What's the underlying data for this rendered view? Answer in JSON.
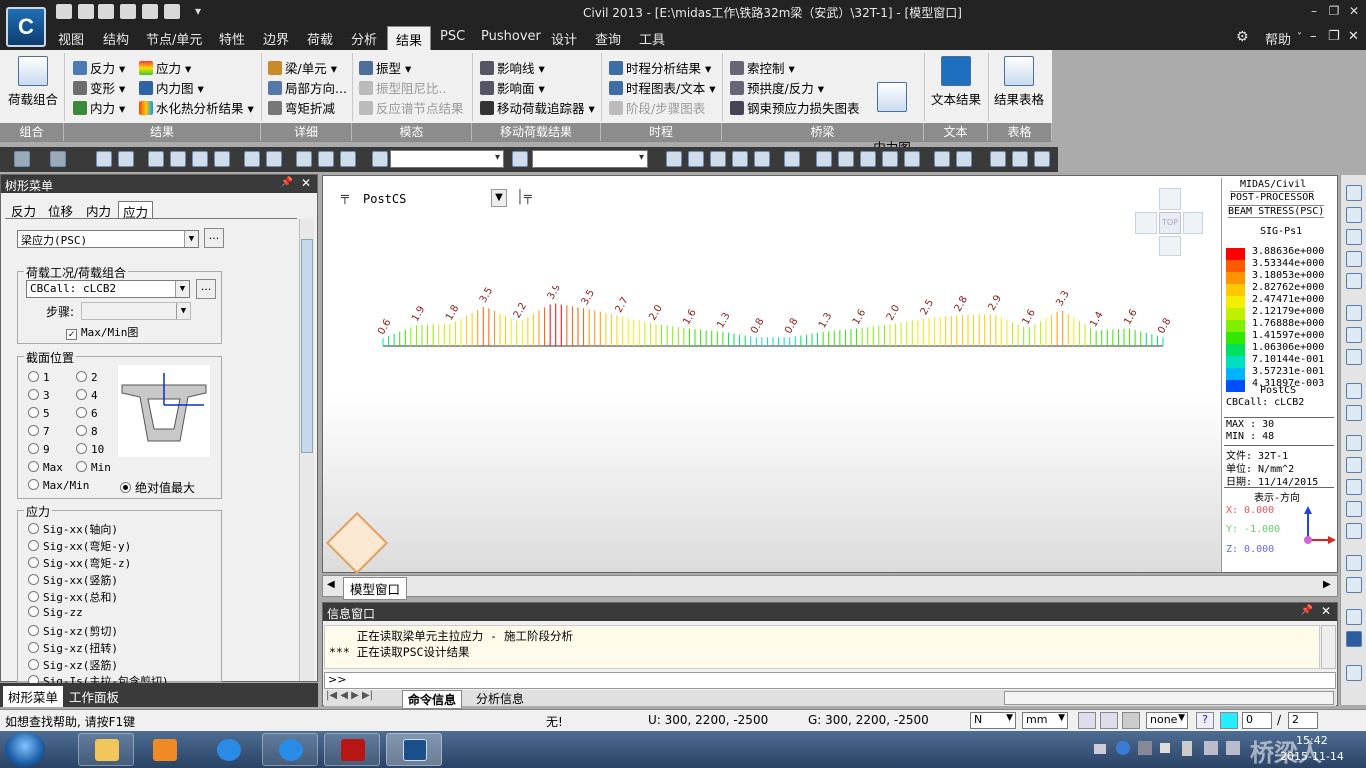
{
  "title": {
    "text": "Civil 2013 - [E:\\midas工作\\铁路32m梁（安武）\\32T-1] - [模型窗口]",
    "logo_letter": "C"
  },
  "menu": {
    "tabs": [
      "视图",
      "结构",
      "节点/单元",
      "特性",
      "边界",
      "荷载",
      "分析",
      "结果",
      "PSC",
      "Pushover",
      "设计",
      "查询",
      "工具"
    ],
    "active": "结果",
    "help": "帮助"
  },
  "ribbon": {
    "combo_big": "荷载组合",
    "results_col1": [
      "反力",
      "变形",
      "内力"
    ],
    "results_col2": [
      "应力",
      "内力图",
      "水化热分析结果"
    ],
    "detail": [
      "梁/单元",
      "局部方向...",
      "弯矩折减"
    ],
    "mode": [
      "振型",
      "振型阻尼比..",
      "反应谱节点结果"
    ],
    "moving": [
      "影响线",
      "影响面",
      "移动荷载追踪器"
    ],
    "timehist": [
      "时程分析结果",
      "时程图表/文本",
      "阶段/步骤图表"
    ],
    "bridge": [
      "索控制",
      "预拱度/反力",
      "钢束预应力损失图表"
    ],
    "bridge_big": "桥梁主梁\n内力图",
    "text_big": "文本结果",
    "table_big": "结果表格",
    "sections": [
      "组合",
      "结果",
      "详细",
      "模态",
      "移动荷载结果",
      "时程",
      "桥梁",
      "文本",
      "表格"
    ]
  },
  "tree": {
    "title": "树形菜单",
    "tabs": [
      "反力",
      "位移",
      "内力",
      "应力"
    ],
    "active_tab": "应力",
    "stress_type": "梁应力(PSC)",
    "case_group_label": "荷载工况/荷载组合",
    "case_value": "CBCall: cLCB2",
    "step_label": "步骤:",
    "maxmin_check": "Max/Min图",
    "section_label": "截面位置",
    "positions": [
      "1",
      "2",
      "3",
      "4",
      "5",
      "6",
      "7",
      "8",
      "9",
      "10",
      "Max",
      "Min",
      "Max/Min",
      "绝对值最大"
    ],
    "selected_position": "绝对值最大",
    "stress_label": "应力",
    "stress_items": [
      "Sig-xx(轴向)",
      "Sig-xx(弯矩-y)",
      "Sig-xx(弯矩-z)",
      "Sig-xx(竖筋)",
      "Sig-xx(总和)",
      "Sig-zz",
      "Sig-xz(剪切)",
      "Sig-xz(扭转)",
      "Sig-xz(竖筋)",
      "Sig-Is(主拉-包含剪切)"
    ],
    "bottom_tabs": [
      "树形菜单",
      "工作面板"
    ]
  },
  "model": {
    "stage_label": "PostCS",
    "tab": "模型窗口",
    "cube_label": "TOP",
    "diagram_labels": [
      "0.6",
      "1.9",
      "1.8",
      "3.5",
      "2.2",
      "3.9",
      "3.5",
      "2.7",
      "2.0",
      "1.6",
      "1.3",
      "0.8",
      "0.8",
      "1.3",
      "1.6",
      "2.0",
      "2.5",
      "2.8",
      "2.9",
      "1.6",
      "3.3",
      "1.4",
      "1.6",
      "0.8"
    ]
  },
  "legend": {
    "header": [
      "MIDAS/Civil",
      "POST-PROCESSOR",
      "BEAM STRESS(PSC)"
    ],
    "component": "SIG-Ps1",
    "values": [
      "3.88636e+000",
      "3.53344e+000",
      "3.18053e+000",
      "2.82762e+000",
      "2.47471e+000",
      "2.12179e+000",
      "1.76888e+000",
      "1.41597e+000",
      "1.06306e+000",
      "7.10144e-001",
      "3.57231e-001",
      "4.31897e-003"
    ],
    "colors": [
      "#ff0000",
      "#ff5a00",
      "#ff9400",
      "#ffc800",
      "#f4ef00",
      "#c0f000",
      "#7ef000",
      "#30e800",
      "#00e060",
      "#00e0c0",
      "#00b4ff",
      "#0050ff"
    ],
    "stage": "PostCS",
    "case": "CBCall: cLCB2",
    "max": "MAX : 30",
    "min": "MIN : 48",
    "file": "文件: 32T-1",
    "unit": "单位: N/mm^2",
    "date": "日期: 11/14/2015",
    "direction_title": "表示-方向",
    "x": "X: 0.000",
    "y": "Y: -1.000",
    "z": "Z: 0.000"
  },
  "messages": {
    "title": "信息窗口",
    "lines": [
      "    正在读取梁单元主拉应力 - 施工阶段分析",
      "*** 正在读取PSC设计结果"
    ],
    "prompt": ">>",
    "tabs": [
      "命令信息",
      "分析信息"
    ]
  },
  "status": {
    "help": "如想查找帮助, 请按F1键",
    "none": "无!",
    "u": "U: 300, 2200, -2500",
    "g": "G: 300, 2200, -2500",
    "force_unit": "N",
    "length_unit": "mm",
    "snap": "none",
    "page": "0",
    "page_total": "2"
  },
  "taskbar": {
    "clock_time": "15:42",
    "clock_date": "2015-11-14",
    "watermark": "桥梁人"
  }
}
